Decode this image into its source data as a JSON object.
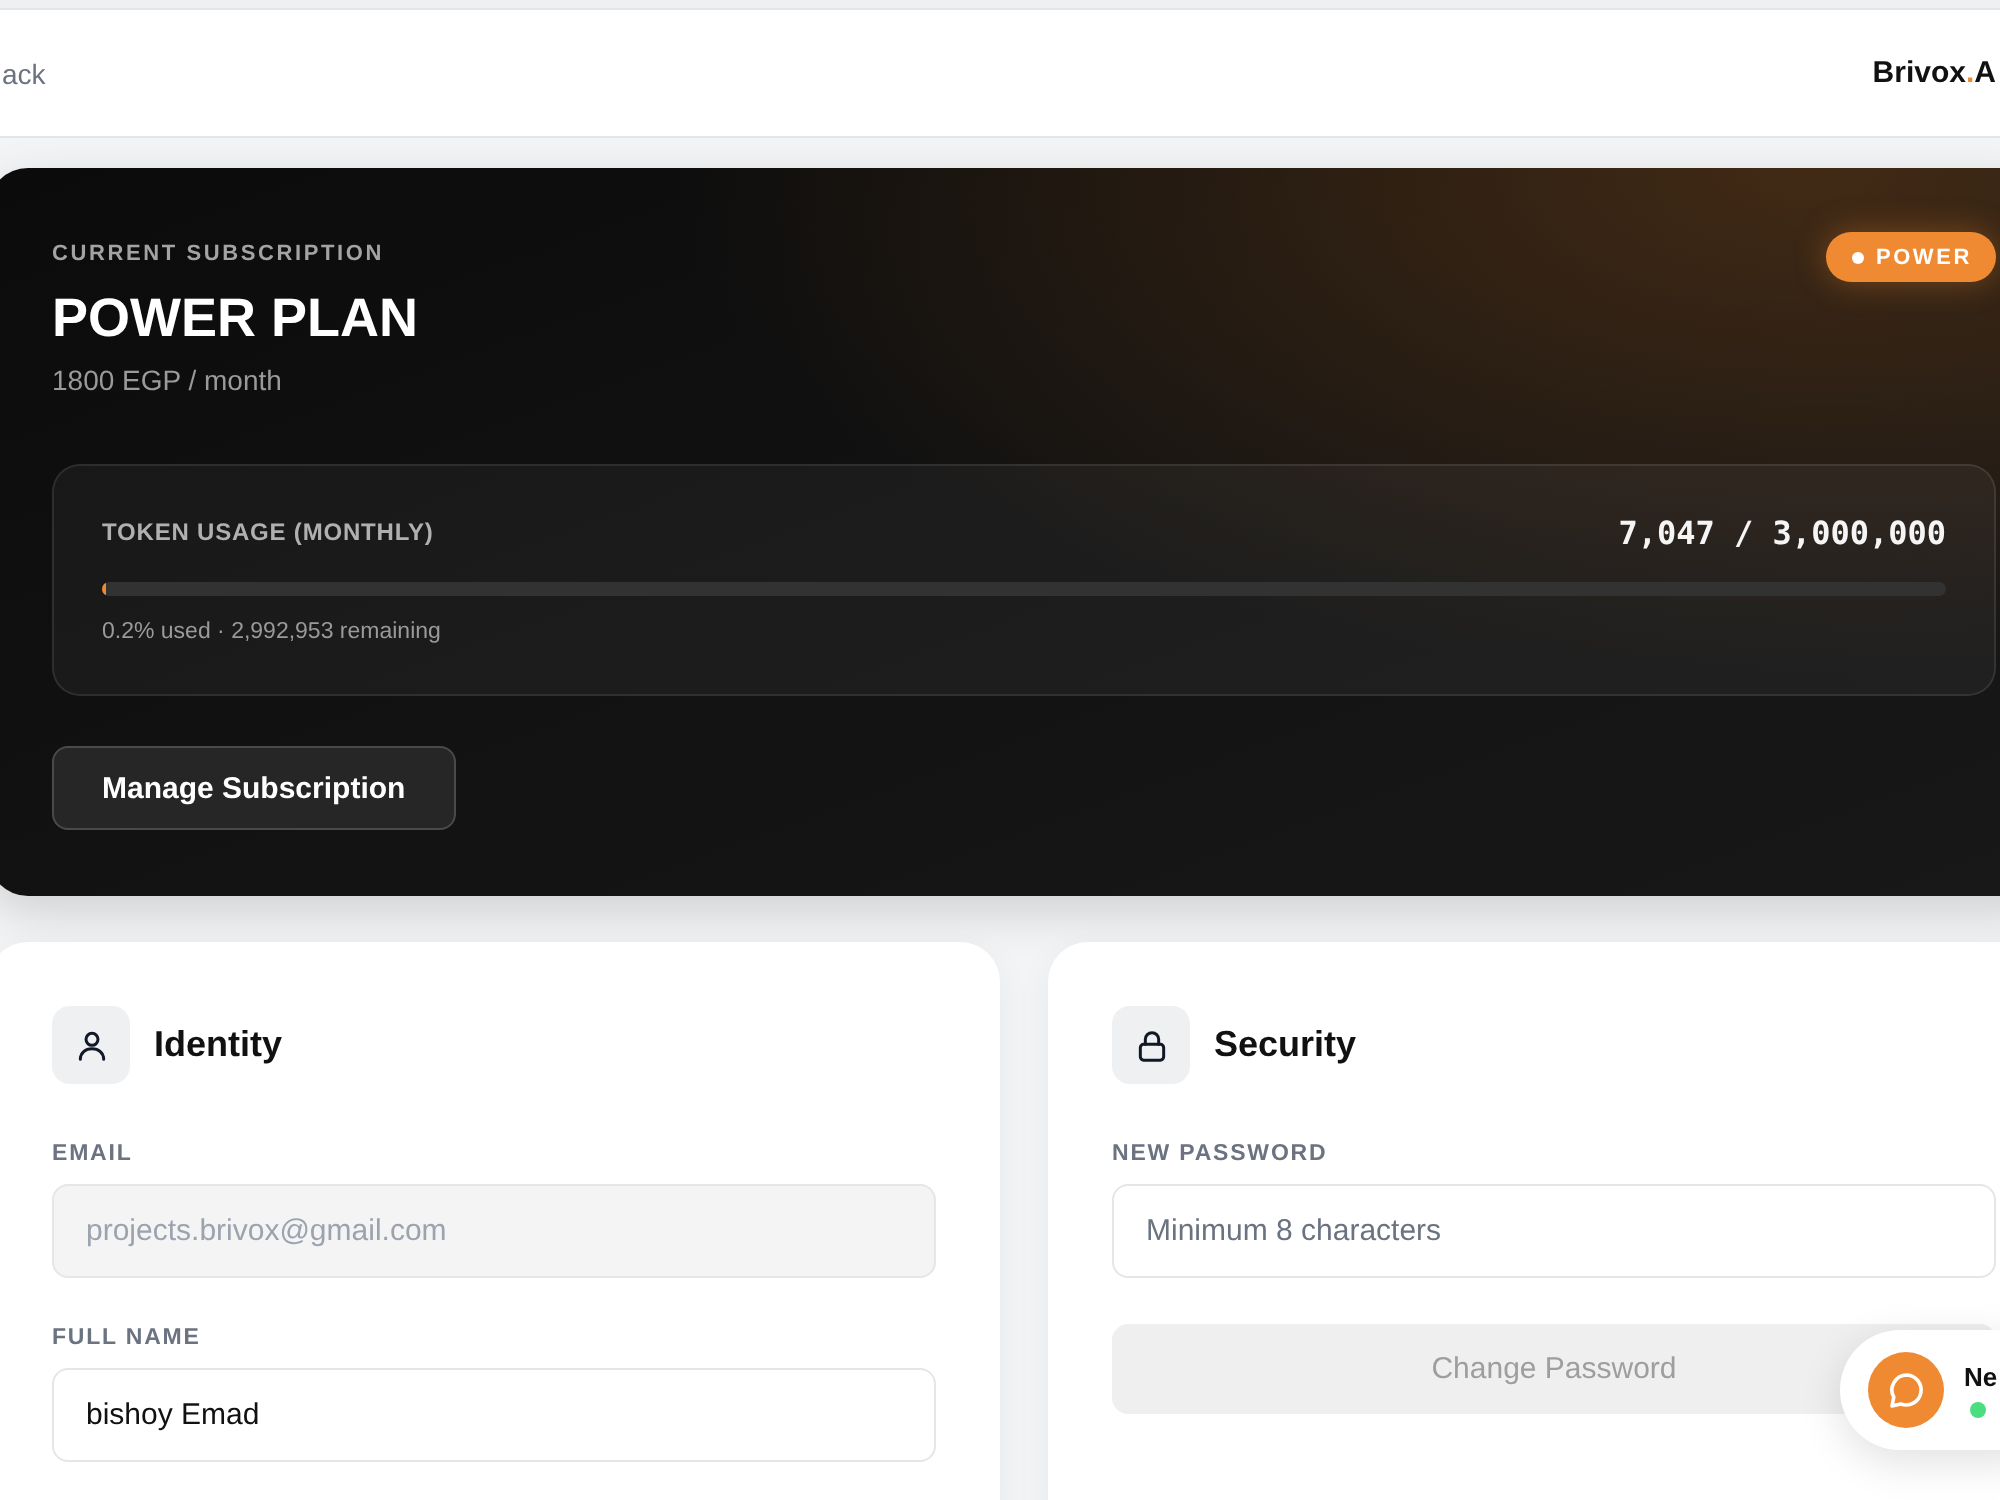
{
  "header": {
    "back_link": "ack",
    "logo": {
      "name": "Brivox",
      "dot": ".",
      "suffix": "A"
    }
  },
  "subscription": {
    "eyebrow": "CURRENT SUBSCRIPTION",
    "plan_name": "POWER PLAN",
    "price": "1800 EGP / month",
    "badge": "POWER",
    "usage": {
      "label": "TOKEN USAGE (MONTHLY)",
      "count": "7,047 / 3,000,000",
      "level": 0.0023,
      "summary": "0.2% used · 2,992,953 remaining"
    },
    "button": "Manage Subscription"
  },
  "identity": {
    "title": "Identity",
    "fields": [
      {
        "label": "EMAIL",
        "value": "projects.brivox@gmail.com",
        "disabled": true
      },
      {
        "label": "FULL NAME",
        "value": "bishoy Emad",
        "disabled": false
      }
    ]
  },
  "security": {
    "title": "Security",
    "fields": [
      {
        "label": "NEW PASSWORD",
        "placeholder": "Minimum 8 characters",
        "disabled": false
      }
    ],
    "button": {
      "label": "Change Password",
      "disabled": true
    }
  },
  "chat_widget": {
    "title": "Ne",
    "online": true
  }
}
